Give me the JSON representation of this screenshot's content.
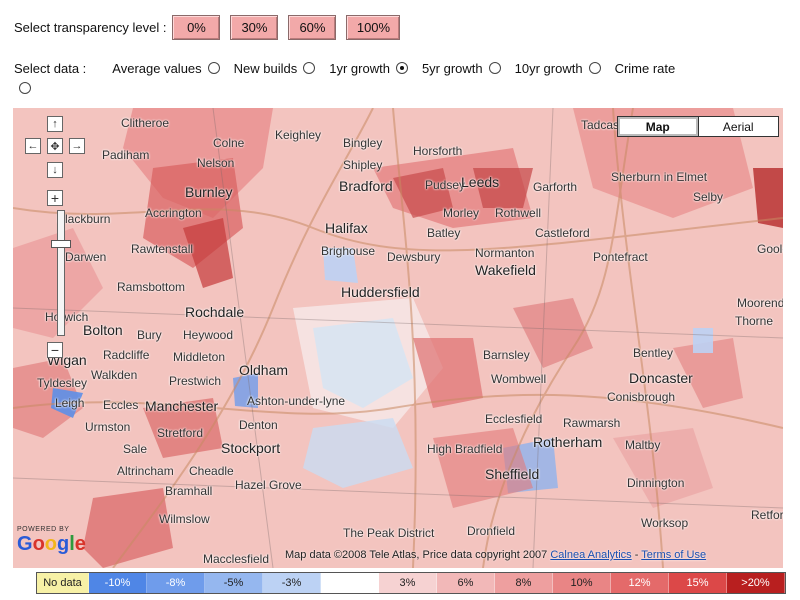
{
  "transparency": {
    "label": "Select transparency level :",
    "buttons": [
      "0%",
      "30%",
      "60%",
      "100%"
    ]
  },
  "data_select": {
    "label": "Select data :",
    "options": [
      "Average values",
      "New builds",
      "1yr growth",
      "5yr growth",
      "10yr growth",
      "Crime rate"
    ],
    "selected": "1yr growth"
  },
  "map": {
    "map_type": {
      "map": "Map",
      "aerial": "Aerial",
      "selected": "Map"
    },
    "places": [
      "Clitheroe",
      "Colne",
      "Keighley",
      "Bingley",
      "Horsforth",
      "Tadcaster",
      "Padiham",
      "Nelson",
      "Shipley",
      "Bradford",
      "Pudsey",
      "Leeds",
      "Garforth",
      "Sherburn in Elmet",
      "Burnley",
      "Selby",
      "Blackburn",
      "Accrington",
      "Morley",
      "Rothwell",
      "Darwen",
      "Rawtenstall",
      "Halifax",
      "Batley",
      "Castleford",
      "Brighouse",
      "Dewsbury",
      "Normanton",
      "Pontefract",
      "Ramsbottom",
      "Wakefield",
      "Huddersfield",
      "Goole",
      "Rochdale",
      "Bolton",
      "Bury",
      "Heywood",
      "Moorends",
      "Horwich",
      "Thorne",
      "Radcliffe",
      "Middleton",
      "Wigan",
      "Barnsley",
      "Bentley",
      "Walkden",
      "Prestwich",
      "Oldham",
      "Tyldesley",
      "Wombwell",
      "Doncaster",
      "Leigh",
      "Eccles",
      "Manchester",
      "Ashton-under-lyne",
      "Conisbrough",
      "Urmston",
      "Stretford",
      "Denton",
      "Ecclesfield",
      "Rawmarsh",
      "Sale",
      "Rotherham",
      "Maltby",
      "Stockport",
      "High Bradfield",
      "Altrincham",
      "Cheadle",
      "Bramhall",
      "Sheffield",
      "Dinnington",
      "Hazel Grove",
      "Wilmslow",
      "Dronfield",
      "Worksop",
      "The Peak District",
      "Retford",
      "Macclesfield"
    ],
    "powered_by": "POWERED BY",
    "google_logo": "Google",
    "attribution_text": "Map data ©2008 Tele Atlas, Price data copyright 2007",
    "attribution_link": "Calnea Analytics",
    "attribution_sep": " - ",
    "terms_link": "Terms of Use"
  },
  "legend": [
    {
      "label": "No data",
      "color": "#f7f1a6"
    },
    {
      "label": "-10%",
      "color": "#4f86e6"
    },
    {
      "label": "-8%",
      "color": "#6f9ceb"
    },
    {
      "label": "-5%",
      "color": "#95b7ef"
    },
    {
      "label": "-3%",
      "color": "#bcd2f4"
    },
    {
      "label": "",
      "color": "#ffffff"
    },
    {
      "label": "3%",
      "color": "#f6d2d2"
    },
    {
      "label": "6%",
      "color": "#f2b8b8"
    },
    {
      "label": "8%",
      "color": "#ee9f9f"
    },
    {
      "label": "10%",
      "color": "#e98585"
    },
    {
      "label": "12%",
      "color": "#e46a6a"
    },
    {
      "label": "15%",
      "color": "#dc4848"
    },
    {
      "label": ">20%",
      "color": "#b81f1f"
    }
  ],
  "icons": [
    "pan-up-icon",
    "pan-left-icon",
    "pan-center-icon",
    "pan-right-icon",
    "pan-down-icon",
    "zoom-in-icon",
    "zoom-out-icon"
  ]
}
